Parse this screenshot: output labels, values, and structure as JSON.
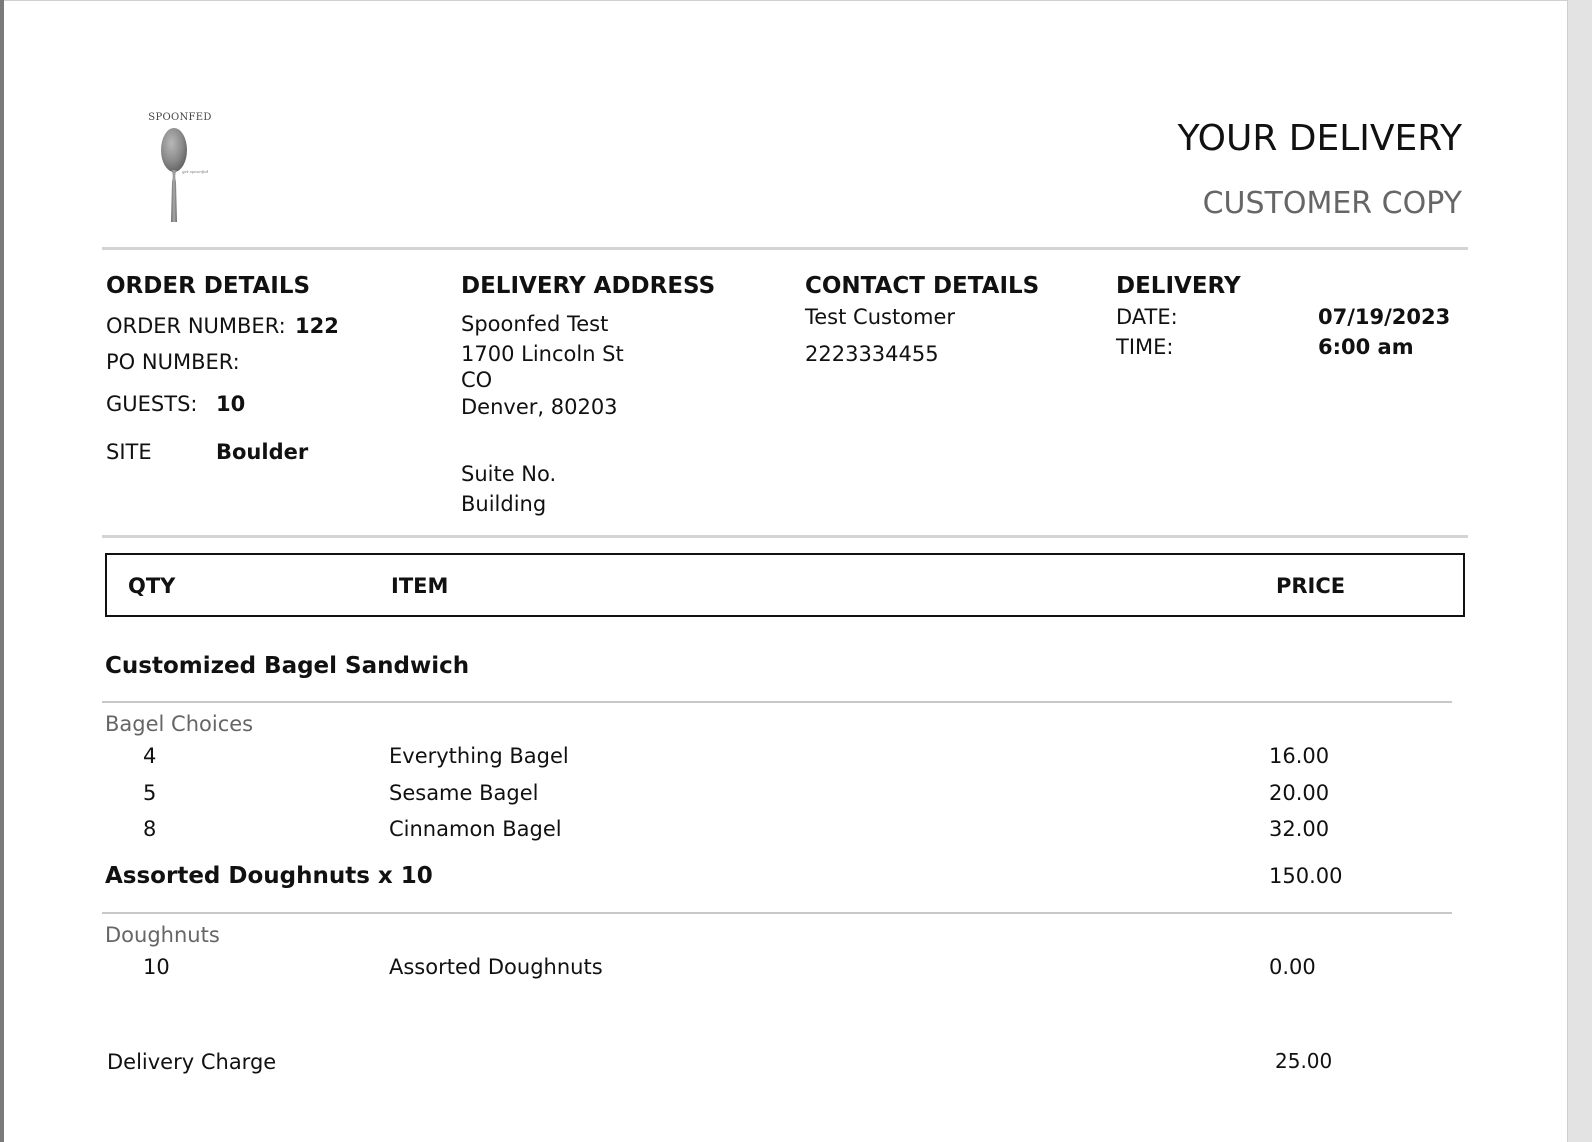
{
  "logo": {
    "brand": "SPOONFED",
    "tagline": "get spoonfed"
  },
  "header": {
    "title": "YOUR DELIVERY",
    "subtitle": "CUSTOMER COPY"
  },
  "order_details": {
    "heading": "ORDER DETAILS",
    "order_number_label": "ORDER NUMBER:",
    "order_number": "122",
    "po_number_label": "PO NUMBER:",
    "po_number": "",
    "guests_label": "GUESTS:",
    "guests": "10",
    "site_label": "SITE",
    "site": "Boulder"
  },
  "delivery_address": {
    "heading": "DELIVERY ADDRESS",
    "name": "Spoonfed Test",
    "street": "1700 Lincoln St",
    "state": "CO",
    "city_zip": "Denver, 80203",
    "suite": "Suite No.",
    "building": "Building"
  },
  "contact_details": {
    "heading": "CONTACT DETAILS",
    "name": "Test Customer",
    "phone": "2223334455"
  },
  "delivery": {
    "heading": "DELIVERY",
    "date_label": "DATE:",
    "date": "07/19/2023",
    "time_label": "TIME:",
    "time": "6:00 am"
  },
  "table": {
    "columns": {
      "qty": "QTY",
      "item": "ITEM",
      "price": "PRICE"
    },
    "groups": [
      {
        "title": "Customized Bagel Sandwich",
        "price": "",
        "subgroup": "Bagel Choices",
        "rows": [
          {
            "qty": "4",
            "item": "Everything Bagel",
            "price": "16.00"
          },
          {
            "qty": "5",
            "item": "Sesame Bagel",
            "price": "20.00"
          },
          {
            "qty": "8",
            "item": "Cinnamon Bagel",
            "price": "32.00"
          }
        ]
      },
      {
        "title": "Assorted Doughnuts x 10",
        "price": "150.00",
        "subgroup": "Doughnuts",
        "rows": [
          {
            "qty": "10",
            "item": "Assorted Doughnuts",
            "price": "0.00"
          }
        ]
      }
    ]
  },
  "delivery_charge": {
    "label": "Delivery Charge",
    "amount": "25.00"
  }
}
